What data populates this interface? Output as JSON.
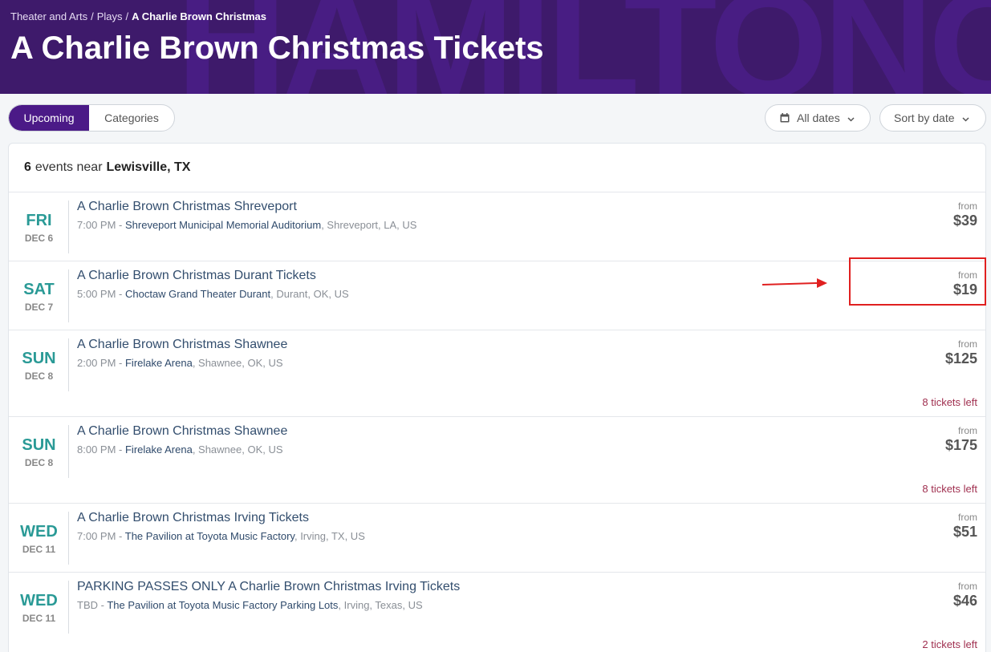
{
  "breadcrumb": {
    "item1": "Theater and Arts",
    "item2": "Plays",
    "current": "A Charlie Brown Christmas",
    "separator": "/"
  },
  "hero": {
    "title": "A Charlie Brown Christmas Tickets",
    "watermark": "HAMILTONOW"
  },
  "tabs": {
    "upcoming": "Upcoming",
    "categories": "Categories"
  },
  "filters": {
    "dates": "All dates",
    "sort": "Sort by date"
  },
  "summary": {
    "count": "6",
    "text": "events near",
    "location": "Lewisville, TX"
  },
  "events": [
    {
      "dow": "FRI",
      "date": "DEC 6",
      "title": "A Charlie Brown Christmas Shreveport",
      "time": "7:00 PM -",
      "venue": "Shreveport Municipal Memorial Auditorium",
      "place": ", Shreveport, LA, US",
      "from": "from",
      "price": "$39",
      "left": ""
    },
    {
      "dow": "SAT",
      "date": "DEC 7",
      "title": "A Charlie Brown Christmas Durant Tickets",
      "time": "5:00 PM -",
      "venue": "Choctaw Grand Theater Durant",
      "place": ", Durant, OK, US",
      "from": "from",
      "price": "$19",
      "left": ""
    },
    {
      "dow": "SUN",
      "date": "DEC 8",
      "title": "A Charlie Brown Christmas Shawnee",
      "time": "2:00 PM -",
      "venue": "Firelake Arena",
      "place": ", Shawnee, OK, US",
      "from": "from",
      "price": "$125",
      "left": "8 tickets left"
    },
    {
      "dow": "SUN",
      "date": "DEC 8",
      "title": "A Charlie Brown Christmas Shawnee",
      "time": "8:00 PM -",
      "venue": "Firelake Arena",
      "place": ", Shawnee, OK, US",
      "from": "from",
      "price": "$175",
      "left": "8 tickets left"
    },
    {
      "dow": "WED",
      "date": "DEC 11",
      "title": "A Charlie Brown Christmas Irving Tickets",
      "time": "7:00 PM -",
      "venue": "The Pavilion at Toyota Music Factory",
      "place": ", Irving, TX, US",
      "from": "from",
      "price": "$51",
      "left": ""
    },
    {
      "dow": "WED",
      "date": "DEC 11",
      "title": "PARKING PASSES ONLY A Charlie Brown Christmas Irving Tickets",
      "time": "TBD -",
      "venue": "The Pavilion at Toyota Music Factory Parking Lots",
      "place": ", Irving, Texas, US",
      "from": "from",
      "price": "$46",
      "left": "2 tickets left"
    }
  ],
  "colors": {
    "header_bg": "#3e1a6b",
    "accent": "#4b1a87",
    "day_teal": "#2a9a96",
    "tickets_left": "#a03050",
    "annotation_red": "#e02020"
  },
  "icons": [
    "calendar-icon",
    "chevron-down-icon"
  ]
}
